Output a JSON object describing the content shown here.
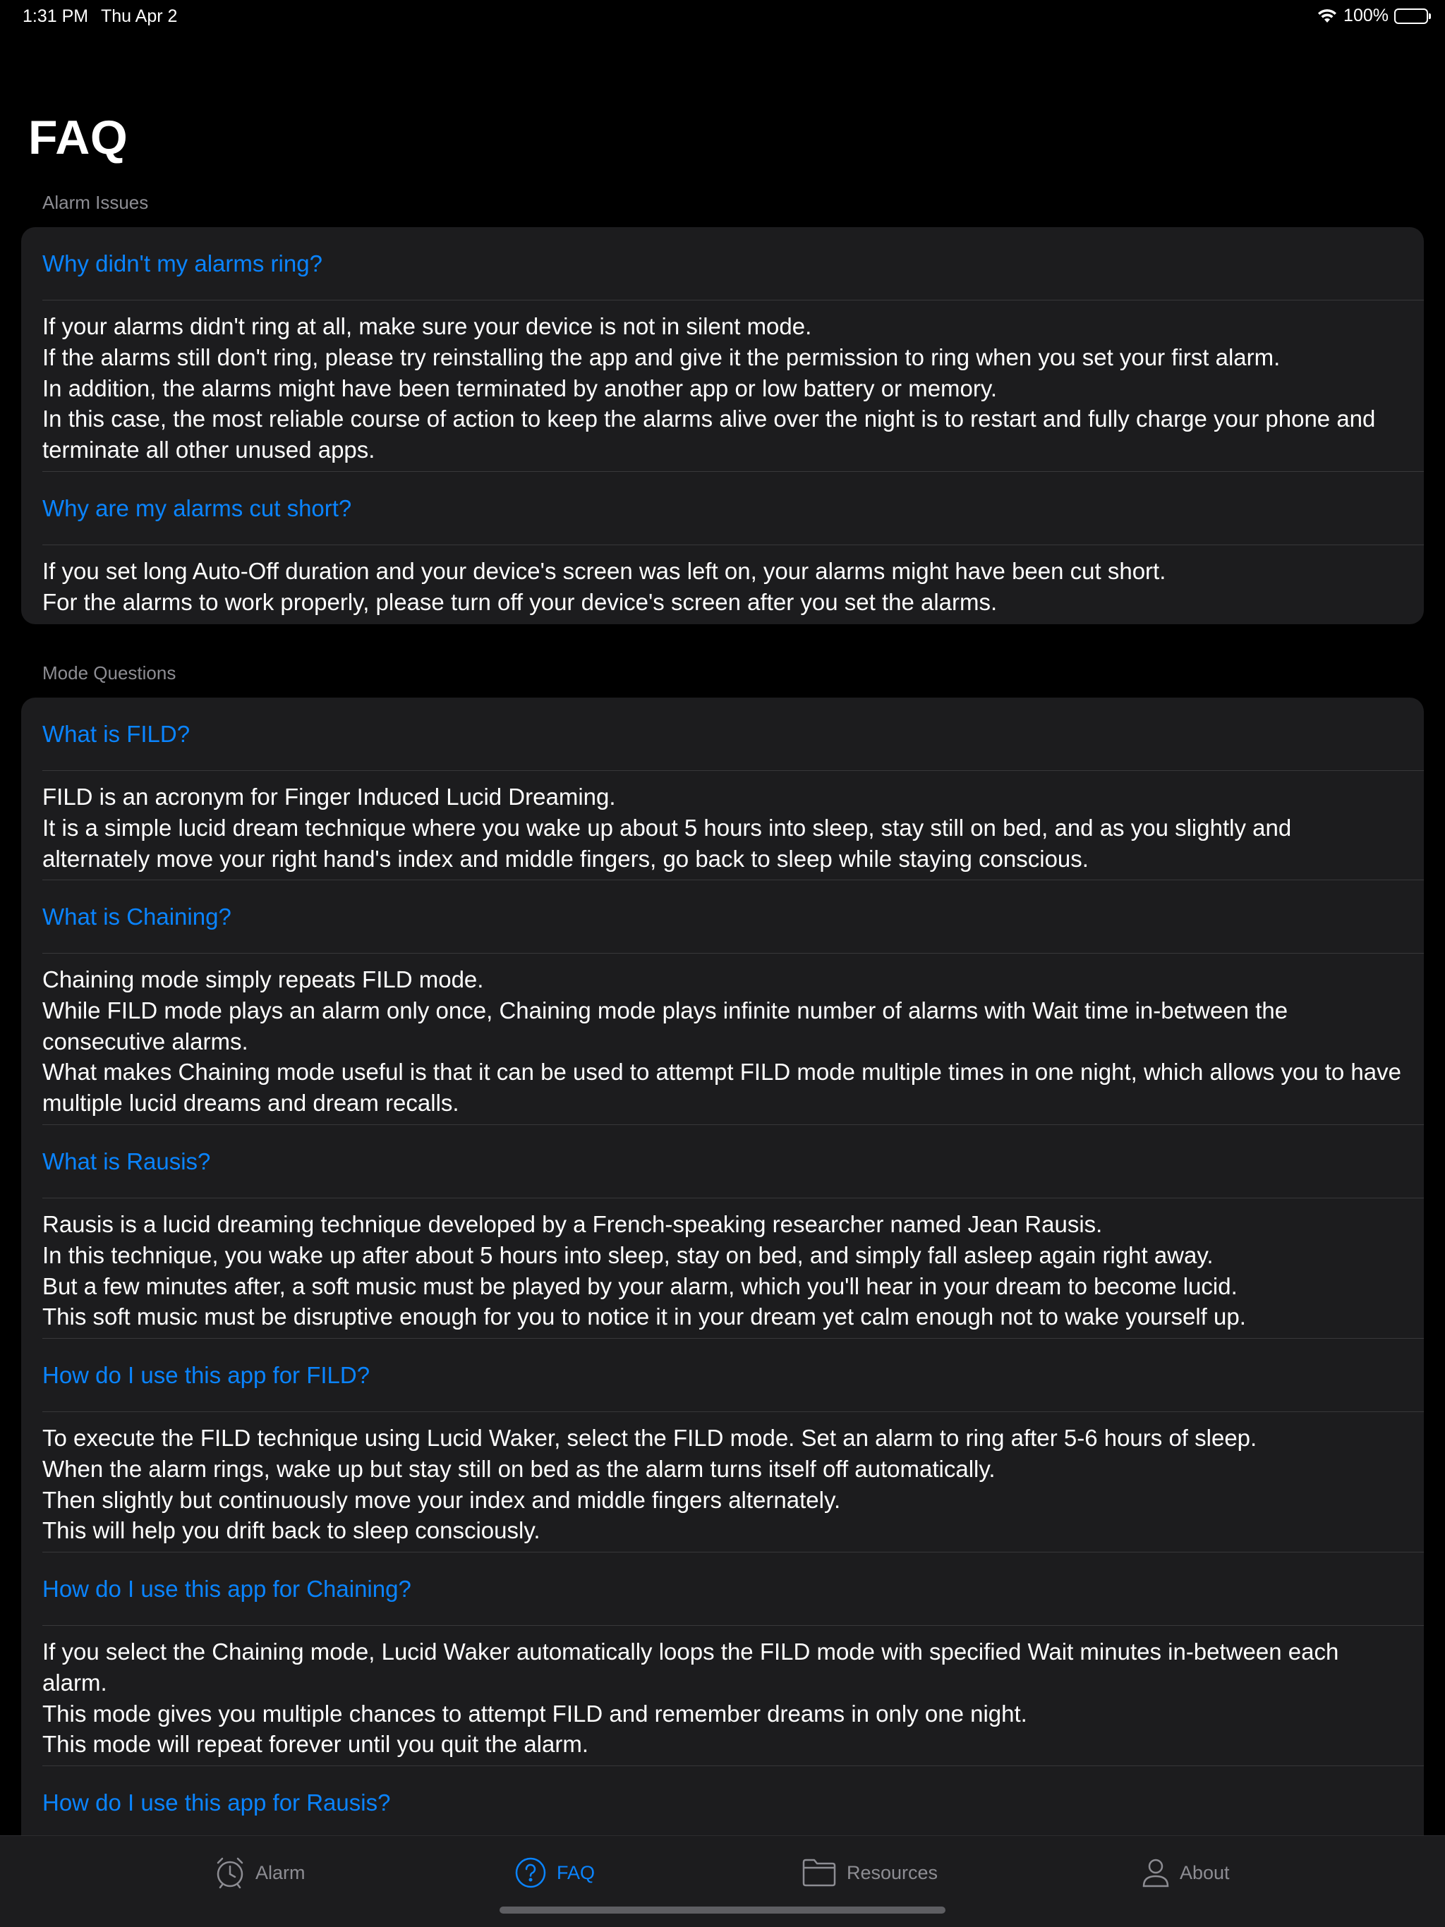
{
  "status_bar": {
    "time": "1:31 PM",
    "date": "Thu Apr 2",
    "battery": "100%",
    "battery_level": 1.0
  },
  "title": "FAQ",
  "sections": [
    {
      "header": "Alarm Issues",
      "items": [
        {
          "question": "Why didn't my alarms ring?",
          "answer": [
            "If your alarms didn't ring at all, make sure your device is not in silent mode.",
            "If the alarms still don't ring, please try reinstalling the app and give it the permission to ring when you set your first alarm.",
            "In addition, the alarms might have been terminated by another app or low battery or memory.",
            "In this case, the most reliable course of action to keep the alarms alive over the night is to restart and fully charge your phone and terminate all other unused apps."
          ]
        },
        {
          "question": "Why are my alarms cut short?",
          "answer": [
            "If you set long Auto-Off duration and your device's screen was left on, your alarms might have been cut short.",
            "For the alarms to work properly, please turn off your device's screen after you set the alarms."
          ]
        }
      ]
    },
    {
      "header": "Mode Questions",
      "items": [
        {
          "question": "What is FILD?",
          "answer": [
            "FILD is an acronym for Finger Induced Lucid Dreaming.",
            "It is a simple lucid dream technique where you wake up about 5 hours into sleep, stay still on bed, and as you slightly and alternately move your right hand's index and middle fingers, go back to sleep while staying conscious."
          ]
        },
        {
          "question": "What is Chaining?",
          "answer": [
            "Chaining mode simply repeats FILD mode.",
            "While FILD mode plays an alarm only once, Chaining mode plays infinite number of alarms with Wait time in-between the consecutive alarms.",
            "What makes Chaining mode useful is that it can be used to attempt FILD mode multiple times in one night, which allows you to have multiple lucid dreams and dream recalls."
          ]
        },
        {
          "question": "What is Rausis?",
          "answer": [
            "Rausis is a lucid dreaming technique developed by a French-speaking researcher named Jean Rausis.",
            "In this technique, you wake up after about 5 hours into sleep, stay on bed, and simply fall asleep again right away.",
            "But a few minutes after, a soft music must be played by your alarm, which you'll hear in your dream to become lucid.",
            "This soft music must be disruptive enough for you to notice it in your dream yet calm enough not to wake yourself up."
          ]
        },
        {
          "question": "How do I use this app for FILD?",
          "answer": [
            "To execute the FILD technique using Lucid Waker, select the FILD mode. Set an alarm to ring after 5-6 hours of sleep.",
            "When the alarm rings, wake up but stay still on bed as the alarm turns itself off automatically.",
            "Then slightly but continuously move your index and middle fingers alternately.",
            "This will help you drift back to sleep consciously."
          ]
        },
        {
          "question": "How do I use this app for Chaining?",
          "answer": [
            "If you select the Chaining mode, Lucid Waker automatically loops the FILD mode with specified Wait minutes in-between each alarm.",
            "This mode gives you multiple chances to attempt FILD and remember dreams in only one night.",
            "This mode will repeat forever until you quit the alarm."
          ]
        },
        {
          "question": "How do I use this app for Rausis?"
        }
      ]
    }
  ],
  "tabs": [
    {
      "label": "Alarm",
      "icon": "alarm-clock-icon",
      "active": false
    },
    {
      "label": "FAQ",
      "icon": "question-circle-icon",
      "active": true
    },
    {
      "label": "Resources",
      "icon": "folder-icon",
      "active": false
    },
    {
      "label": "About",
      "icon": "person-icon",
      "active": false
    }
  ],
  "colors": {
    "accent": "#0a84ff",
    "background": "#000000",
    "card": "#1c1c1e",
    "secondary_text": "#8d8d93",
    "separator": "#38383a"
  }
}
